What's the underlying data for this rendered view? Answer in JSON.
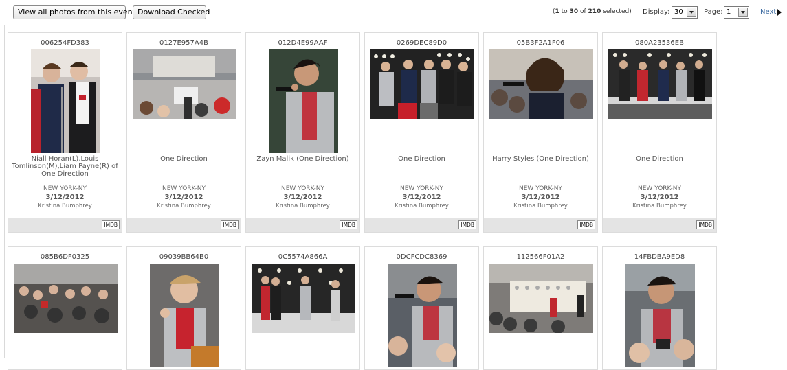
{
  "toolbar": {
    "view_all_label": "View all photos from this event",
    "download_label": "Download Checked"
  },
  "pagination": {
    "range_start": "1",
    "range_to": "to",
    "range_end": "30",
    "of": "of",
    "total": "210",
    "selected_suffix": "selected)",
    "display_label": "Display:",
    "display_value": "30",
    "page_label": "Page:",
    "page_value": "1",
    "next_label": "Next"
  },
  "photos": [
    {
      "code": "006254FD383",
      "caption": "Niall Horan(L),Louis Tomlinson(M),Liam Payne(R) of One Direction",
      "location": "NEW YORK-NY",
      "date": "3/12/2012",
      "photographer": "Kristina Bumphrey",
      "imdb": "IMDB"
    },
    {
      "code": "0127E957A4B",
      "caption": "One Direction",
      "location": "NEW YORK-NY",
      "date": "3/12/2012",
      "photographer": "Kristina Bumphrey",
      "imdb": "IMDB"
    },
    {
      "code": "012D4E99AAF",
      "caption": "Zayn Malik (One Direction)",
      "location": "NEW YORK-NY",
      "date": "3/12/2012",
      "photographer": "Kristina Bumphrey",
      "imdb": "IMDB"
    },
    {
      "code": "0269DEC89D0",
      "caption": "One Direction",
      "location": "NEW YORK-NY",
      "date": "3/12/2012",
      "photographer": "Kristina Bumphrey",
      "imdb": "IMDB"
    },
    {
      "code": "05B3F2A1F06",
      "caption": "Harry Styles (One Direction)",
      "location": "NEW YORK-NY",
      "date": "3/12/2012",
      "photographer": "Kristina Bumphrey",
      "imdb": "IMDB"
    },
    {
      "code": "080A23536EB",
      "caption": "One Direction",
      "location": "NEW YORK-NY",
      "date": "3/12/2012",
      "photographer": "Kristina Bumphrey",
      "imdb": "IMDB"
    },
    {
      "code": "085B6DF0325"
    },
    {
      "code": "09039BB64B0"
    },
    {
      "code": "0C5574A866A"
    },
    {
      "code": "0DCFCDC8369"
    },
    {
      "code": "112566F01A2"
    },
    {
      "code": "14FBDBA9ED8"
    }
  ],
  "colors": {
    "link": "#3b6aa0",
    "card_border": "#dcdcdc",
    "footer_bg": "#e4e4e4"
  },
  "icons": {
    "next": "triangle-right-icon",
    "dropdown": "chevron-down-icon"
  }
}
